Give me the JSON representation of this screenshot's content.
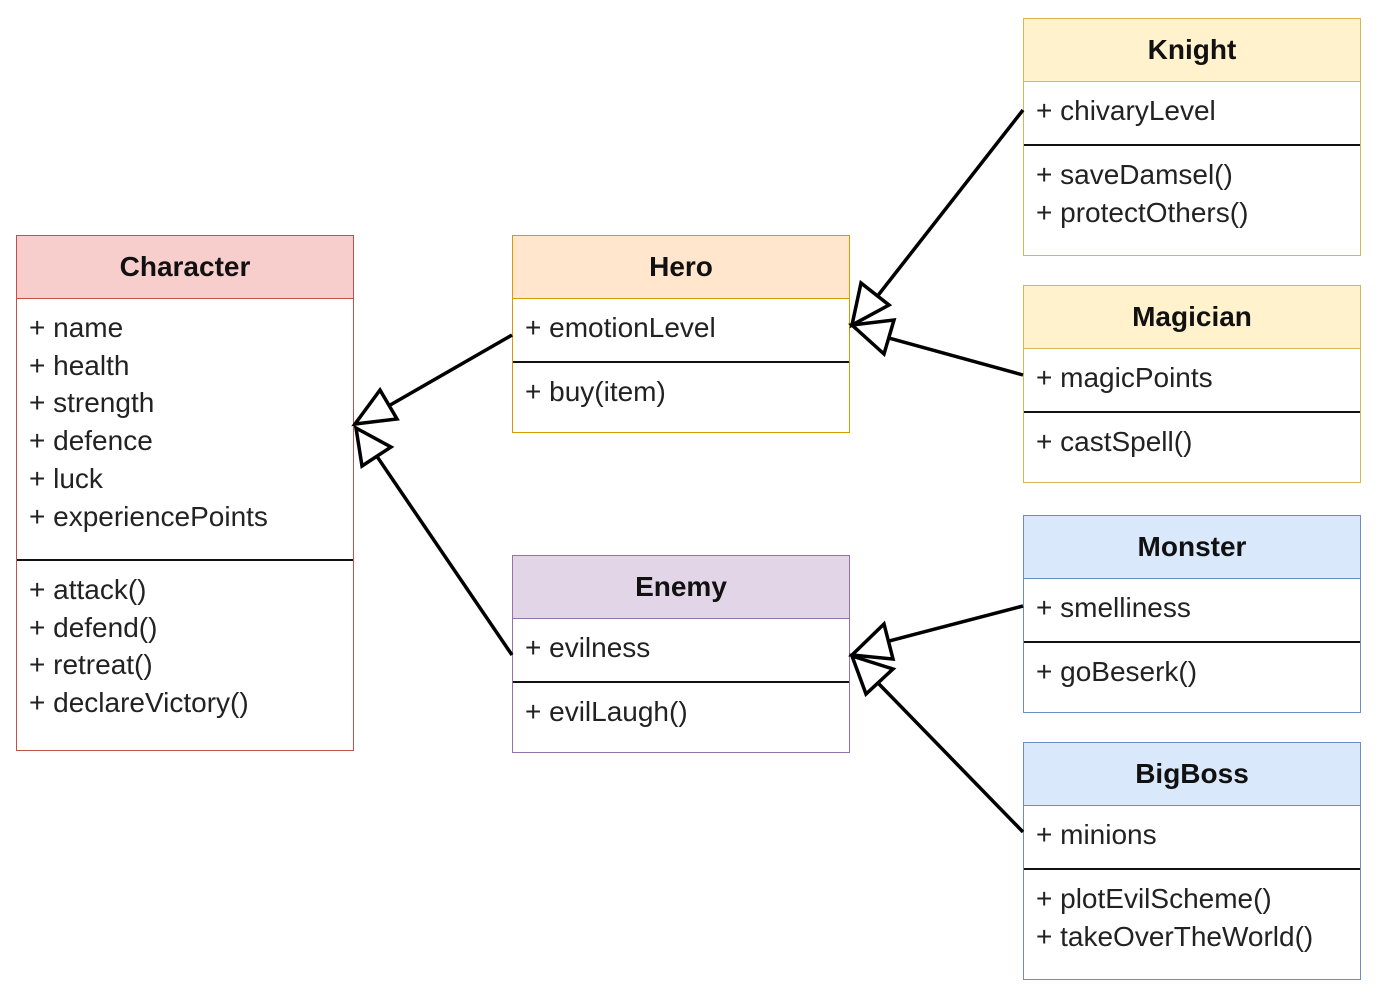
{
  "diagram": {
    "type": "UML class diagram",
    "classes": [
      {
        "id": "character",
        "name": "Character",
        "header_color": "#f8cecc",
        "border_color": "#c0504d",
        "attributes": [
          "+ name",
          "+ health",
          "+ strength",
          "+ defence",
          "+ luck",
          "+ experiencePoints"
        ],
        "methods": [
          "+ attack()",
          "+ defend()",
          "+ retreat()",
          "+ declareVictory()"
        ]
      },
      {
        "id": "hero",
        "name": "Hero",
        "header_color": "#ffe6cc",
        "border_color": "#d79b00",
        "attributes": [
          "+ emotionLevel"
        ],
        "methods": [
          "+ buy(item)"
        ]
      },
      {
        "id": "enemy",
        "name": "Enemy",
        "header_color": "#e1d5e7",
        "border_color": "#9673a6",
        "attributes": [
          "+ evilness"
        ],
        "methods": [
          "+ evilLaugh()"
        ]
      },
      {
        "id": "knight",
        "name": "Knight",
        "header_color": "#fff2cc",
        "border_color": "#d6b656",
        "attributes": [
          "+ chivaryLevel"
        ],
        "methods": [
          "+ saveDamsel()",
          "+ protectOthers()"
        ]
      },
      {
        "id": "magician",
        "name": "Magician",
        "header_color": "#fff2cc",
        "border_color": "#d6b656",
        "attributes": [
          "+ magicPoints"
        ],
        "methods": [
          "+ castSpell()"
        ]
      },
      {
        "id": "monster",
        "name": "Monster",
        "header_color": "#dae8fc",
        "border_color": "#6c8ebf",
        "attributes": [
          "+ smelliness"
        ],
        "methods": [
          "+ goBeserk()"
        ]
      },
      {
        "id": "bigboss",
        "name": "BigBoss",
        "header_color": "#dae8fc",
        "border_color": "#6c8ebf",
        "attributes": [
          "+ minions"
        ],
        "methods": [
          "+ plotEvilScheme()",
          "+ takeOverTheWorld()"
        ]
      }
    ],
    "relationships": [
      {
        "type": "generalization",
        "from": "hero",
        "to": "character"
      },
      {
        "type": "generalization",
        "from": "enemy",
        "to": "character"
      },
      {
        "type": "generalization",
        "from": "knight",
        "to": "hero"
      },
      {
        "type": "generalization",
        "from": "magician",
        "to": "hero"
      },
      {
        "type": "generalization",
        "from": "monster",
        "to": "enemy"
      },
      {
        "type": "generalization",
        "from": "bigboss",
        "to": "enemy"
      }
    ]
  }
}
